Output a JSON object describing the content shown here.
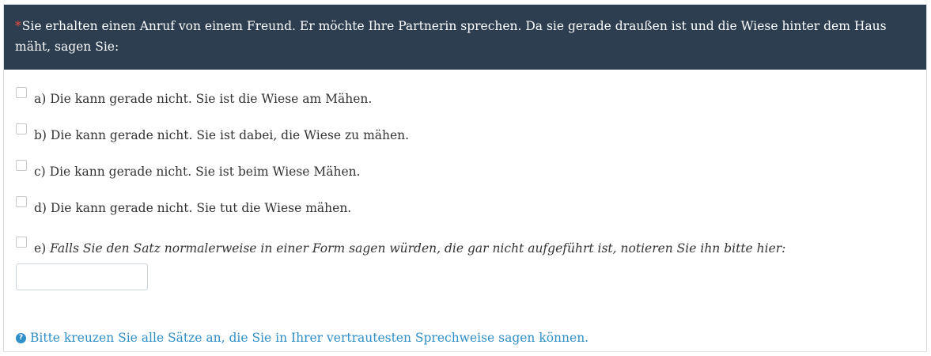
{
  "question": {
    "required_marker": "*",
    "text": "Sie erhalten einen Anruf von einem Freund. Er möchte Ihre Partnerin sprechen. Da sie gerade draußen ist und die Wiese hinter dem Haus mäht, sagen Sie:"
  },
  "options": [
    {
      "label": "a) Die kann gerade nicht. Sie ist die Wiese am Mähen.",
      "checked": false
    },
    {
      "label": "b) Die kann gerade nicht. Sie ist dabei, die Wiese zu mähen.",
      "checked": false
    },
    {
      "label": "c) Die kann gerade nicht. Sie ist beim Wiese Mähen.",
      "checked": false
    },
    {
      "label": "d) Die kann gerade nicht. Sie tut die Wiese mähen.",
      "checked": false
    },
    {
      "letter": "e) ",
      "label": "Falls Sie den Satz normalerweise in einer Form sagen würden, die gar nicht aufgeführt ist, notieren Sie ihn bitte hier:",
      "checked": false
    }
  ],
  "other_input": {
    "value": "",
    "placeholder": ""
  },
  "help": {
    "icon": "question-circle-icon",
    "text": "Bitte kreuzen Sie alle Sätze an, die Sie in Ihrer vertrautesten Sprechweise sagen können."
  },
  "colors": {
    "header_bg": "#2c3e50",
    "required": "#e74c3c",
    "help_text": "#2f8fc8"
  }
}
